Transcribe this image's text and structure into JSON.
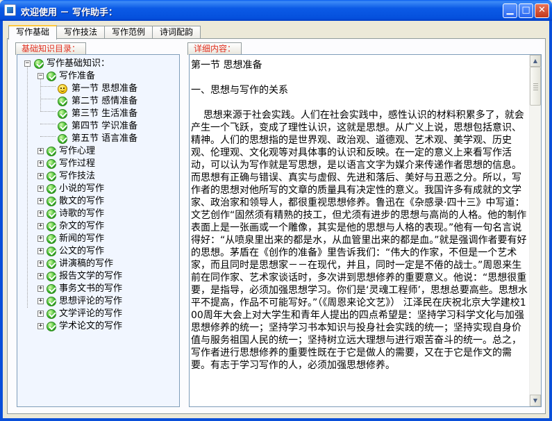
{
  "window": {
    "title": "欢迎使用 － 写作助手：",
    "min_glyph": "▁",
    "max_glyph": "□",
    "close_glyph": "✕"
  },
  "tabs": [
    {
      "label": "写作基础",
      "active": true
    },
    {
      "label": "写作技法",
      "active": false
    },
    {
      "label": "写作范例",
      "active": false
    },
    {
      "label": "诗词配韵",
      "active": false
    }
  ],
  "left_panel": {
    "label": "基础知识目录："
  },
  "right_panel": {
    "label": "详细内容："
  },
  "tree": {
    "root": {
      "label": "写作基础知识：",
      "toggle": "−"
    },
    "items": [
      {
        "label": "写作准备",
        "toggle": "−",
        "children": [
          {
            "label": "第一节 思想准备",
            "icon": "smiley"
          },
          {
            "label": "第二节 感情准备",
            "icon": "gem"
          },
          {
            "label": "第三节 生活准备",
            "icon": "gem"
          },
          {
            "label": "第四节 学识准备",
            "icon": "gem"
          },
          {
            "label": "第五节 语言准备",
            "icon": "gem"
          }
        ]
      },
      {
        "label": "写作心理",
        "toggle": "+"
      },
      {
        "label": "写作过程",
        "toggle": "+"
      },
      {
        "label": "写作技法",
        "toggle": "+"
      },
      {
        "label": "小说的写作",
        "toggle": "+"
      },
      {
        "label": "散文的写作",
        "toggle": "+"
      },
      {
        "label": "诗歌的写作",
        "toggle": "+"
      },
      {
        "label": "杂文的写作",
        "toggle": "+"
      },
      {
        "label": "新闻的写作",
        "toggle": "+"
      },
      {
        "label": "公文的写作",
        "toggle": "+"
      },
      {
        "label": "讲演稿的写作",
        "toggle": "+"
      },
      {
        "label": "报告文学的写作",
        "toggle": "+"
      },
      {
        "label": "事务文书的写作",
        "toggle": "+"
      },
      {
        "label": "思想评论的写作",
        "toggle": "+"
      },
      {
        "label": "文学评论的写作",
        "toggle": "+"
      },
      {
        "label": "学术论文的写作",
        "toggle": "+"
      }
    ]
  },
  "detail": {
    "text": "第一节 思想准备\n\n一、思想与写作的关系\n\n    思想来源于社会实践。人们在社会实践中，感性认识的材料积累多了，就会产生一个飞跃，变成了理性认识，这就是思想。从广义上说，思想包括意识、精神。人们的思想指的是世界观、政治观、道德观、艺术观、美学观、历史观、伦理观、文化观等对具体事的认识和反映。在一定的意义上来看写作活动，可以认为写作就是写思想，是以语言文字为媒介来传递作者思想的信息。而思想有正确与错误、真实与虚假、先进和落后、美好与丑恶之分。所以，写作者的思想对他所写的文章的质量具有决定性的意义。我国许多有成就的文学家、政治家和领导人，都很重视思想修养。鲁迅在《杂感录·四十三》中写道：文艺创作“固然须有精熟的技工，但尤须有进步的思想与高尚的人格。他的制作表面上是一张画或一个雕像，其实是他的思想与人格的表现。”他有一句名言说得好：“从喷泉里出来的都是水，从血管里出来的都是血。”就是强调作者要有好的思想。茅盾在《创作的准备》里告诉我们：“伟大的作家，不但是一个艺术家，而且同时是思想家－－在现代，并且，同时一定是不倦的战士。”周恩来生前在同作家、艺术家谈话时，多次讲到思想修养的重要意义。他说：“思想很重要，是指导，必须加强思想学习。你们是‘灵魂工程师’，思想总要高些。思想水平不提高，作品不可能写好。”（《周恩来论文艺》） 江泽民在庆祝北京大学建校100周年大会上对大学生和青年人提出的四点希望是：坚持学习科学文化与加强思想修养的统一；坚持学习书本知识与投身社会实践的统一；坚持实现自身价值与服务祖国人民的统一；坚持树立远大理想与进行艰苦奋斗的统一。总之，写作者进行思想修养的重要性既在于它是做人的需要，又在于它是作文的需要。有志于学习写作的人，必须加强思想修养。"
  },
  "scrollbar": {
    "up_glyph": "▲",
    "down_glyph": "▼"
  }
}
